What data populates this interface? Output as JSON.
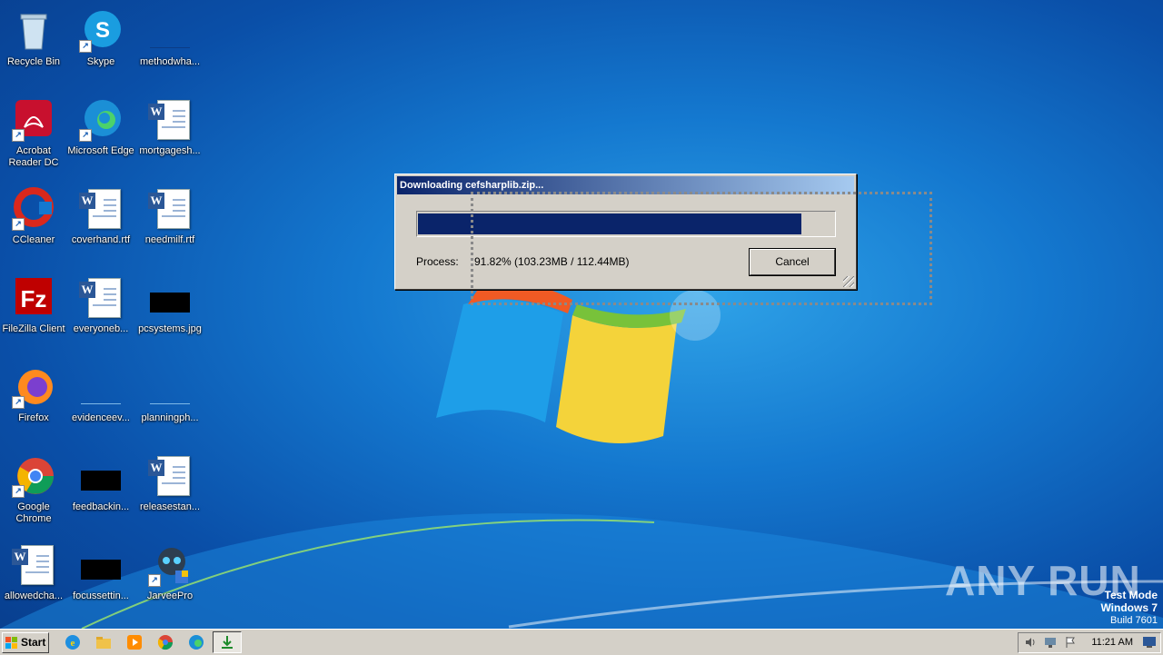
{
  "desktop": {
    "icons": [
      {
        "label": "Recycle Bin"
      },
      {
        "label": "Skype"
      },
      {
        "label": "methodwha..."
      },
      {
        "label": "Acrobat Reader DC"
      },
      {
        "label": "Microsoft Edge"
      },
      {
        "label": "mortgagesh..."
      },
      {
        "label": "CCleaner"
      },
      {
        "label": "coverhand.rtf"
      },
      {
        "label": "needmilf.rtf"
      },
      {
        "label": "FileZilla Client"
      },
      {
        "label": "everyoneb..."
      },
      {
        "label": "pcsystems.jpg"
      },
      {
        "label": "Firefox"
      },
      {
        "label": "evidenceev..."
      },
      {
        "label": "planningph..."
      },
      {
        "label": "Google Chrome"
      },
      {
        "label": "feedbackin..."
      },
      {
        "label": "releasestan..."
      },
      {
        "label": "allowedcha..."
      },
      {
        "label": "focussettin..."
      },
      {
        "label": "JarveePro"
      }
    ]
  },
  "dialog": {
    "title": "Downloading cefsharplib.zip...",
    "progress_fraction": 0.9182,
    "process_label": "Process:",
    "process_value": "91.82% (103.23MB / 112.44MB)",
    "cancel_label": "Cancel"
  },
  "watermark": {
    "text": "ANY RUN"
  },
  "system": {
    "mode": "Test Mode",
    "os": "Windows 7",
    "build": "Build 7601"
  },
  "taskbar": {
    "start_label": "Start",
    "clock": "11:21 AM"
  },
  "colors": {
    "dialog_title_start": "#0a246a",
    "progress_fill": "#0a246a",
    "taskbar": "#d4d0c8"
  }
}
